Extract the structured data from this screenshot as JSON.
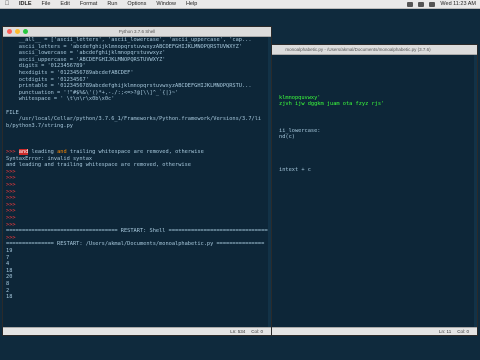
{
  "menubar": {
    "apple": "",
    "items": [
      "IDLE",
      "File",
      "Edit",
      "Format",
      "Run",
      "Options",
      "Window",
      "Help"
    ],
    "clock": "Wed 11:23 AM"
  },
  "shell": {
    "title": "Python 3.7.6 Shell",
    "lines": [
      {
        "t": "    __all__ = ['ascii_letters', 'ascii_lowercase', 'ascii_uppercase', 'cap...",
        "c": "cmt"
      },
      {
        "t": "    ascii_letters = 'abcdefghijklmnopqrstuvwxyzABCDEFGHIJKLMNOPQRSTUVWXYZ'",
        "c": "cmt"
      },
      {
        "t": "    ascii_lowercase = 'abcdefghijklmnopqrstuvwxyz'",
        "c": "cmt"
      },
      {
        "t": "    ascii_uppercase = 'ABCDEFGHIJKLMNOPQRSTUVWXYZ'",
        "c": "cmt"
      },
      {
        "t": "    digits = '0123456789'",
        "c": "cmt"
      },
      {
        "t": "    hexdigits = '0123456789abcdefABCDEF'",
        "c": "cmt"
      },
      {
        "t": "    octdigits = '01234567'",
        "c": "cmt"
      },
      {
        "t": "    printable = '0123456789abcdefghijklmnopqrstuvwxyzABCDEFGHIJKLMNOPQRSTU...",
        "c": "cmt"
      },
      {
        "t": "    punctuation = '!\"#$%&\\'()*+,-./:;<=>?@[\\\\]^_`{|}~'",
        "c": "cmt"
      },
      {
        "t": "    whitespace = ' \\t\\n\\r\\x0b\\x0c'",
        "c": "cmt"
      },
      {
        "t": "",
        "c": ""
      },
      {
        "t": "FILE",
        "c": "cmt"
      },
      {
        "t": "    /usr/local/Cellar/python/3.7.6_1/Frameworks/Python.framework/Versions/3.7/li",
        "c": "cmt"
      },
      {
        "t": "b/python3.7/string.py",
        "c": "cmt"
      },
      {
        "t": "",
        "c": ""
      },
      {
        "t": "",
        "c": ""
      },
      {
        "t": "",
        "c": ""
      },
      {
        "t": "__SYNTAX__",
        "c": "special"
      },
      {
        "t": "SyntaxError: invalid syntax",
        "c": "cmt"
      },
      {
        "t": "and leading and trailing whitespace are removed, otherwise",
        "c": "cmt"
      },
      {
        "t": ">>>",
        "c": "err"
      },
      {
        "t": ">>>",
        "c": "err"
      },
      {
        "t": ">>>",
        "c": "err"
      },
      {
        "t": ">>>",
        "c": "err"
      },
      {
        "t": ">>>",
        "c": "err"
      },
      {
        "t": ">>>",
        "c": "err"
      },
      {
        "t": ">>>",
        "c": "err"
      },
      {
        "t": ">>>",
        "c": "err"
      },
      {
        "t": ">>>",
        "c": "err"
      },
      {
        "t": "=================================== RESTART: Shell ===================================",
        "c": "cmt"
      },
      {
        "t": ">>>",
        "c": "err"
      },
      {
        "t": "=============== RESTART: /Users/akmal/Documents/monoalphabetic.py ===============",
        "c": "cmt"
      },
      {
        "t": "19",
        "c": "cmt"
      },
      {
        "t": "7",
        "c": "cmt"
      },
      {
        "t": "4",
        "c": "cmt"
      },
      {
        "t": "18",
        "c": "cmt"
      },
      {
        "t": "20",
        "c": "cmt"
      },
      {
        "t": "8",
        "c": "cmt"
      },
      {
        "t": "2",
        "c": "cmt"
      },
      {
        "t": "18",
        "c": "cmt"
      }
    ],
    "syntax_prompt": ">>>",
    "syntax_hl": "and",
    "syntax_mid": " leading ",
    "syntax_kw": "and",
    "syntax_rest": " trailing whitespace are removed, otherwise",
    "status": {
      "ln": "Ln: 534",
      "col": "Col: 0"
    }
  },
  "editor": {
    "title": "monoalphabetic.py - /Users/akmal/Documents/monoalphabetic.py (3.7.6)",
    "lines": [
      {
        "t": "",
        "c": ""
      },
      {
        "t": "",
        "c": ""
      },
      {
        "t": "",
        "c": ""
      },
      {
        "t": "",
        "c": ""
      },
      {
        "t": "",
        "c": ""
      },
      {
        "t": "",
        "c": ""
      },
      {
        "t": "klmnopquvwxy'",
        "c": "grn"
      },
      {
        "t": "zjvh ijw dggkm juam ota fzyz rjs'",
        "c": "grn"
      },
      {
        "t": "",
        "c": ""
      },
      {
        "t": "",
        "c": ""
      },
      {
        "t": "",
        "c": ""
      },
      {
        "t": "ii_lowercase:",
        "c": "cmt"
      },
      {
        "t": "nd(c)",
        "c": "cmt"
      },
      {
        "t": "",
        "c": ""
      },
      {
        "t": "",
        "c": ""
      },
      {
        "t": "",
        "c": ""
      },
      {
        "t": "",
        "c": ""
      },
      {
        "t": "intext + c",
        "c": "cmt"
      }
    ],
    "status": {
      "ln": "Ln: 11",
      "col": "Col: 0"
    }
  }
}
